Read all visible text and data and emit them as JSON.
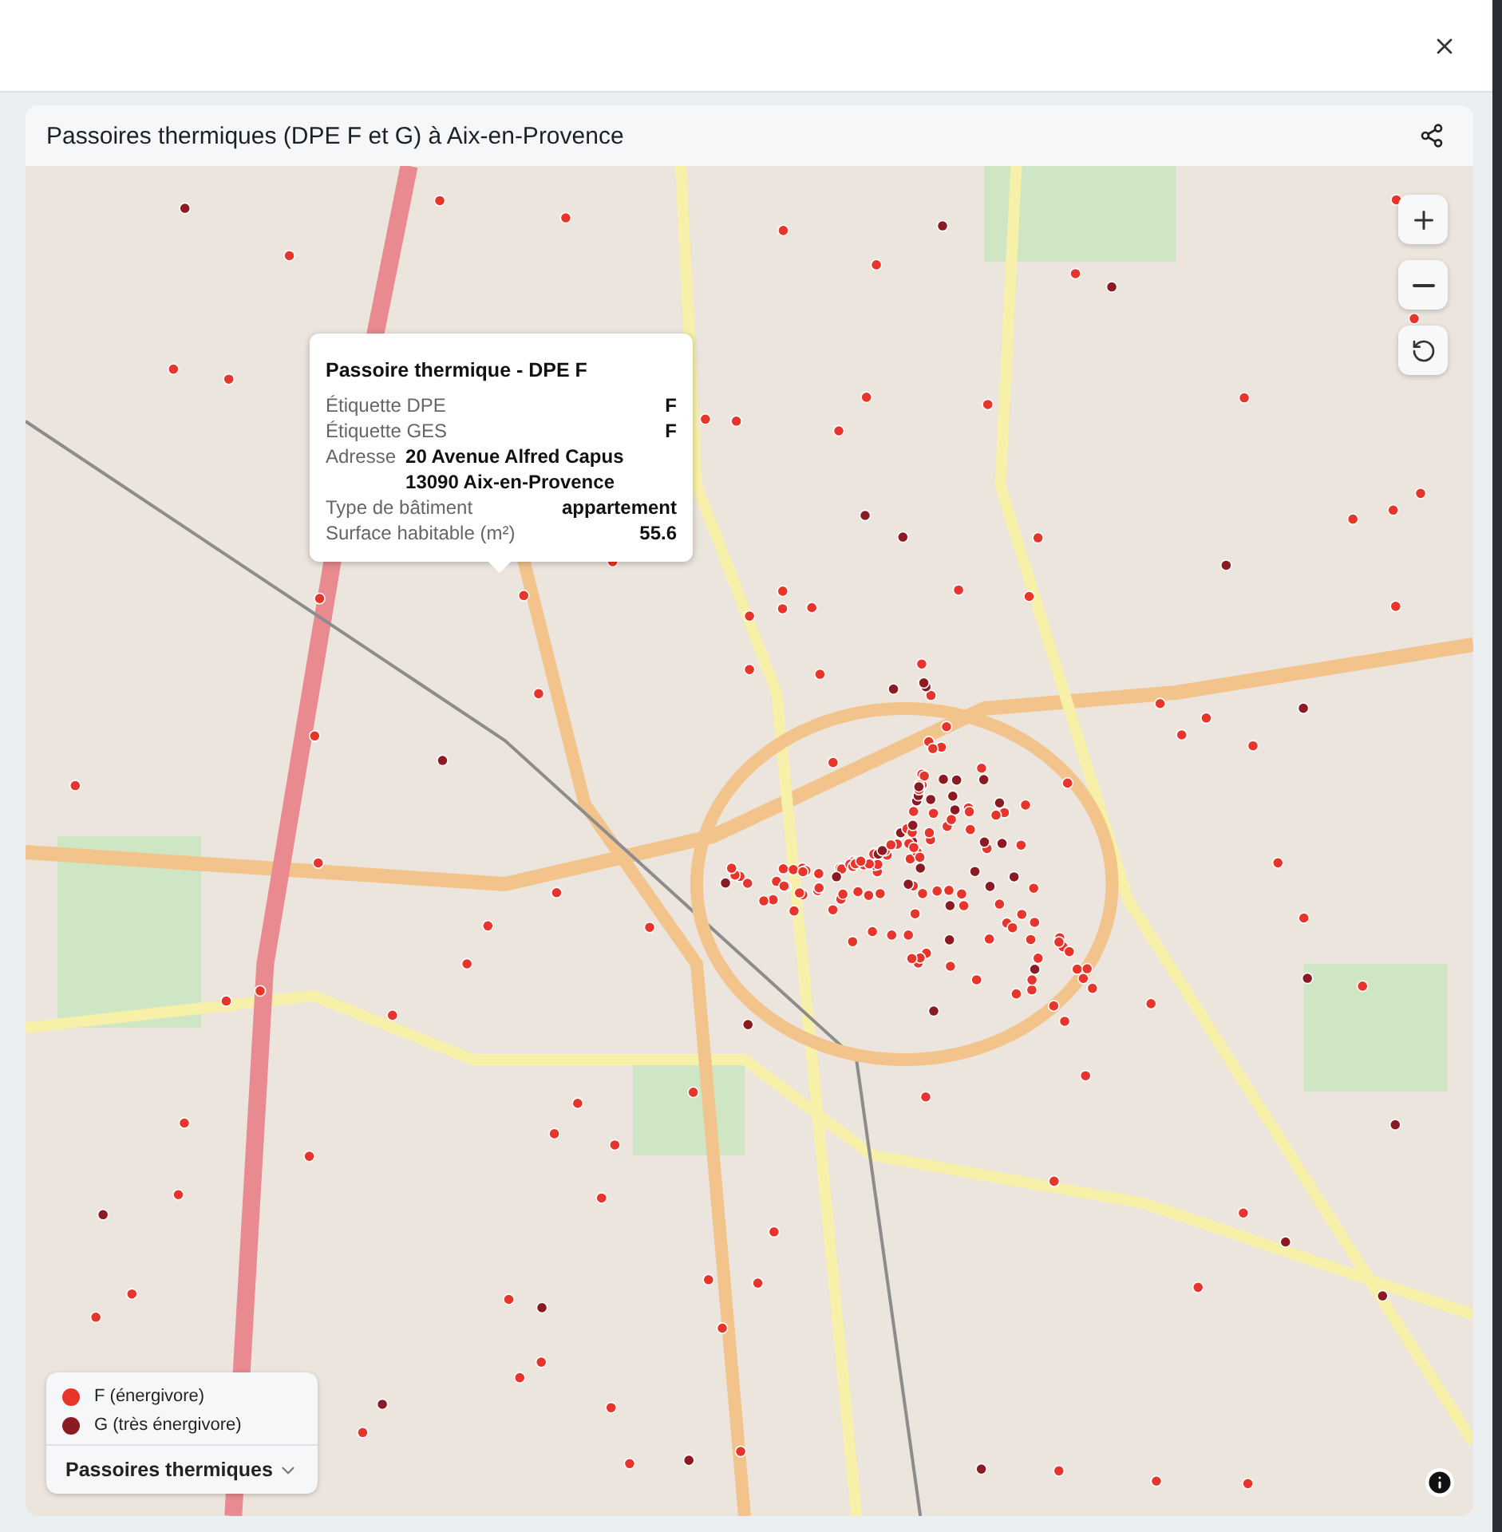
{
  "card": {
    "title": "Passoires thermiques (DPE F et G) à Aix-en-Provence"
  },
  "popup": {
    "title": "Passoire thermique - DPE F",
    "rows": [
      {
        "kind": "field",
        "label": "Étiquette DPE",
        "value": "F"
      },
      {
        "kind": "field",
        "label": "Étiquette GES",
        "value": "F"
      },
      {
        "kind": "address",
        "label": "Adresse",
        "lines": [
          "20 Avenue Alfred Capus",
          "13090 Aix-en-Provence"
        ]
      },
      {
        "kind": "field",
        "label": "Type de bâtiment",
        "value": "appartement"
      },
      {
        "kind": "field",
        "label": "Surface habitable (m²)",
        "value": "55.6"
      }
    ]
  },
  "legend": {
    "items": [
      {
        "label": "F (énergivore)",
        "color": "#e8352b"
      },
      {
        "label": "G (très énergivore)",
        "color": "#8b1a22"
      }
    ],
    "layer": "Passoires thermiques"
  }
}
